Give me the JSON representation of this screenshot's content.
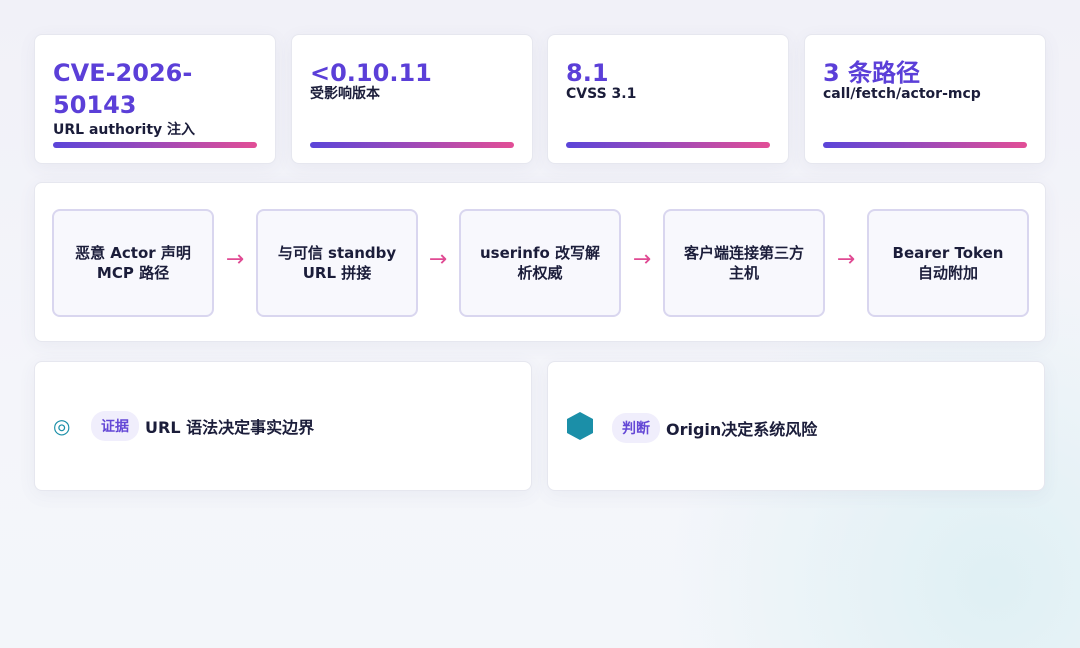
{
  "stats": [
    {
      "value": "CVE-2026-50143",
      "label": "URL authority 注入"
    },
    {
      "value": "<0.10.11",
      "label": "受影响版本"
    },
    {
      "value": "8.1",
      "label": "CVSS 3.1"
    },
    {
      "value": "3 条路径",
      "label": "call/fetch/actor-mcp"
    }
  ],
  "flow": [
    "恶意 Actor 声明 MCP 路径",
    "与可信 standby URL 拼接",
    "userinfo 改写解析权威",
    "客户端连接第三方主机",
    "Bearer Token 自动附加"
  ],
  "arrow": "→",
  "evidence": {
    "icon": "◎",
    "tag": "证据",
    "text": "URL 语法决定事实边界"
  },
  "judgment": {
    "tag": "判断",
    "text": "Origin决定系统风险"
  },
  "colors": {
    "accent": "#5b3fd8",
    "gradient_start": "#5b45d9",
    "gradient_end": "#e24e96",
    "arrow": "#e04a93",
    "teal": "#1b8fa8"
  }
}
